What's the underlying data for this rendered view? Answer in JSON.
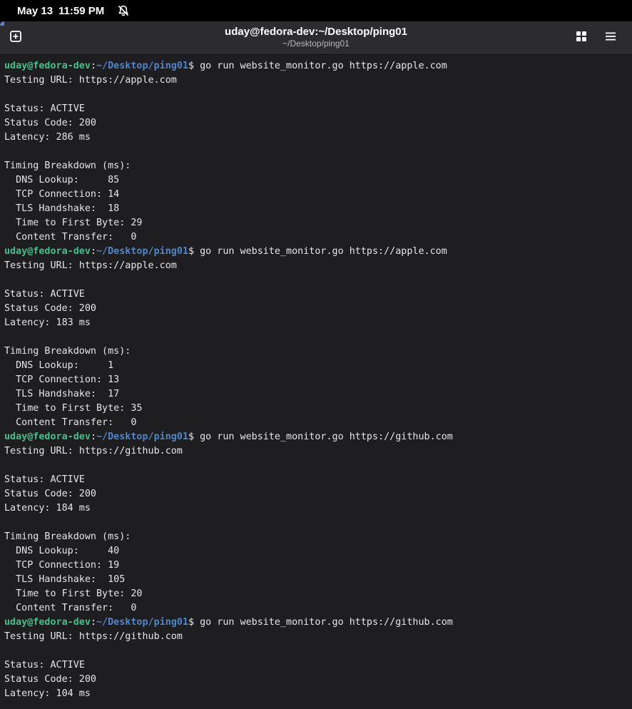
{
  "system_bar": {
    "date": "May 13",
    "time": "11:59 PM",
    "notification_icon": "bell-off-icon"
  },
  "window": {
    "title": "uday@fedora-dev:~/Desktop/ping01",
    "subtitle": "~/Desktop/ping01",
    "icons": {
      "new_tab": "new-tab-icon",
      "view": "grid-icon",
      "menu": "hamburger-menu-icon"
    }
  },
  "colors": {
    "prompt_user": "#3fc28a",
    "prompt_path": "#4f86c9",
    "background": "#1e1e21",
    "text": "#e6e6e6"
  },
  "terminal": {
    "prompt": {
      "user_host": "uday@fedora-dev",
      "path": "~/Desktop/ping01",
      "symbol": "$"
    },
    "lines": [
      {
        "type": "prompt",
        "command": "go run website_monitor.go https://apple.com"
      },
      {
        "type": "output",
        "text": "Testing URL: https://apple.com"
      },
      {
        "type": "output",
        "text": ""
      },
      {
        "type": "output",
        "text": "Status: ACTIVE"
      },
      {
        "type": "output",
        "text": "Status Code: 200"
      },
      {
        "type": "output",
        "text": "Latency: 286 ms"
      },
      {
        "type": "output",
        "text": ""
      },
      {
        "type": "output",
        "text": "Timing Breakdown (ms):"
      },
      {
        "type": "output",
        "text": "  DNS Lookup:     85"
      },
      {
        "type": "output",
        "text": "  TCP Connection: 14"
      },
      {
        "type": "output",
        "text": "  TLS Handshake:  18"
      },
      {
        "type": "output",
        "text": "  Time to First Byte: 29"
      },
      {
        "type": "output",
        "text": "  Content Transfer:   0"
      },
      {
        "type": "prompt",
        "command": "go run website_monitor.go https://apple.com"
      },
      {
        "type": "output",
        "text": "Testing URL: https://apple.com"
      },
      {
        "type": "output",
        "text": ""
      },
      {
        "type": "output",
        "text": "Status: ACTIVE"
      },
      {
        "type": "output",
        "text": "Status Code: 200"
      },
      {
        "type": "output",
        "text": "Latency: 183 ms"
      },
      {
        "type": "output",
        "text": ""
      },
      {
        "type": "output",
        "text": "Timing Breakdown (ms):"
      },
      {
        "type": "output",
        "text": "  DNS Lookup:     1"
      },
      {
        "type": "output",
        "text": "  TCP Connection: 13"
      },
      {
        "type": "output",
        "text": "  TLS Handshake:  17"
      },
      {
        "type": "output",
        "text": "  Time to First Byte: 35"
      },
      {
        "type": "output",
        "text": "  Content Transfer:   0"
      },
      {
        "type": "prompt",
        "command": "go run website_monitor.go https://github.com"
      },
      {
        "type": "output",
        "text": "Testing URL: https://github.com"
      },
      {
        "type": "output",
        "text": ""
      },
      {
        "type": "output",
        "text": "Status: ACTIVE"
      },
      {
        "type": "output",
        "text": "Status Code: 200"
      },
      {
        "type": "output",
        "text": "Latency: 184 ms"
      },
      {
        "type": "output",
        "text": ""
      },
      {
        "type": "output",
        "text": "Timing Breakdown (ms):"
      },
      {
        "type": "output",
        "text": "  DNS Lookup:     40"
      },
      {
        "type": "output",
        "text": "  TCP Connection: 19"
      },
      {
        "type": "output",
        "text": "  TLS Handshake:  105"
      },
      {
        "type": "output",
        "text": "  Time to First Byte: 20"
      },
      {
        "type": "output",
        "text": "  Content Transfer:   0"
      },
      {
        "type": "prompt",
        "command": "go run website_monitor.go https://github.com"
      },
      {
        "type": "output",
        "text": "Testing URL: https://github.com"
      },
      {
        "type": "output",
        "text": ""
      },
      {
        "type": "output",
        "text": "Status: ACTIVE"
      },
      {
        "type": "output",
        "text": "Status Code: 200"
      },
      {
        "type": "output",
        "text": "Latency: 104 ms"
      }
    ]
  }
}
